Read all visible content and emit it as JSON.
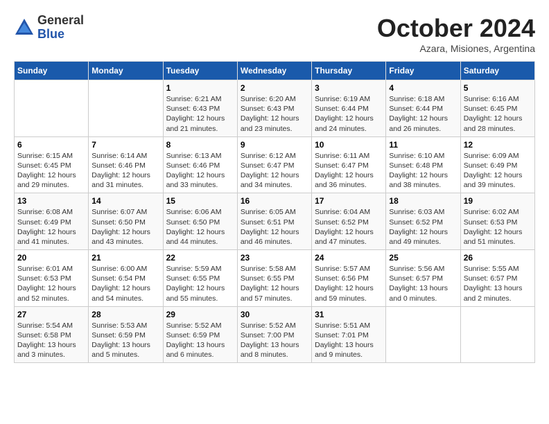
{
  "logo": {
    "general": "General",
    "blue": "Blue"
  },
  "header": {
    "month": "October 2024",
    "location": "Azara, Misiones, Argentina"
  },
  "days_of_week": [
    "Sunday",
    "Monday",
    "Tuesday",
    "Wednesday",
    "Thursday",
    "Friday",
    "Saturday"
  ],
  "weeks": [
    [
      {
        "day": "",
        "info": ""
      },
      {
        "day": "",
        "info": ""
      },
      {
        "day": "1",
        "info": "Sunrise: 6:21 AM\nSunset: 6:43 PM\nDaylight: 12 hours and 21 minutes."
      },
      {
        "day": "2",
        "info": "Sunrise: 6:20 AM\nSunset: 6:43 PM\nDaylight: 12 hours and 23 minutes."
      },
      {
        "day": "3",
        "info": "Sunrise: 6:19 AM\nSunset: 6:44 PM\nDaylight: 12 hours and 24 minutes."
      },
      {
        "day": "4",
        "info": "Sunrise: 6:18 AM\nSunset: 6:44 PM\nDaylight: 12 hours and 26 minutes."
      },
      {
        "day": "5",
        "info": "Sunrise: 6:16 AM\nSunset: 6:45 PM\nDaylight: 12 hours and 28 minutes."
      }
    ],
    [
      {
        "day": "6",
        "info": "Sunrise: 6:15 AM\nSunset: 6:45 PM\nDaylight: 12 hours and 29 minutes."
      },
      {
        "day": "7",
        "info": "Sunrise: 6:14 AM\nSunset: 6:46 PM\nDaylight: 12 hours and 31 minutes."
      },
      {
        "day": "8",
        "info": "Sunrise: 6:13 AM\nSunset: 6:46 PM\nDaylight: 12 hours and 33 minutes."
      },
      {
        "day": "9",
        "info": "Sunrise: 6:12 AM\nSunset: 6:47 PM\nDaylight: 12 hours and 34 minutes."
      },
      {
        "day": "10",
        "info": "Sunrise: 6:11 AM\nSunset: 6:47 PM\nDaylight: 12 hours and 36 minutes."
      },
      {
        "day": "11",
        "info": "Sunrise: 6:10 AM\nSunset: 6:48 PM\nDaylight: 12 hours and 38 minutes."
      },
      {
        "day": "12",
        "info": "Sunrise: 6:09 AM\nSunset: 6:49 PM\nDaylight: 12 hours and 39 minutes."
      }
    ],
    [
      {
        "day": "13",
        "info": "Sunrise: 6:08 AM\nSunset: 6:49 PM\nDaylight: 12 hours and 41 minutes."
      },
      {
        "day": "14",
        "info": "Sunrise: 6:07 AM\nSunset: 6:50 PM\nDaylight: 12 hours and 43 minutes."
      },
      {
        "day": "15",
        "info": "Sunrise: 6:06 AM\nSunset: 6:50 PM\nDaylight: 12 hours and 44 minutes."
      },
      {
        "day": "16",
        "info": "Sunrise: 6:05 AM\nSunset: 6:51 PM\nDaylight: 12 hours and 46 minutes."
      },
      {
        "day": "17",
        "info": "Sunrise: 6:04 AM\nSunset: 6:52 PM\nDaylight: 12 hours and 47 minutes."
      },
      {
        "day": "18",
        "info": "Sunrise: 6:03 AM\nSunset: 6:52 PM\nDaylight: 12 hours and 49 minutes."
      },
      {
        "day": "19",
        "info": "Sunrise: 6:02 AM\nSunset: 6:53 PM\nDaylight: 12 hours and 51 minutes."
      }
    ],
    [
      {
        "day": "20",
        "info": "Sunrise: 6:01 AM\nSunset: 6:53 PM\nDaylight: 12 hours and 52 minutes."
      },
      {
        "day": "21",
        "info": "Sunrise: 6:00 AM\nSunset: 6:54 PM\nDaylight: 12 hours and 54 minutes."
      },
      {
        "day": "22",
        "info": "Sunrise: 5:59 AM\nSunset: 6:55 PM\nDaylight: 12 hours and 55 minutes."
      },
      {
        "day": "23",
        "info": "Sunrise: 5:58 AM\nSunset: 6:55 PM\nDaylight: 12 hours and 57 minutes."
      },
      {
        "day": "24",
        "info": "Sunrise: 5:57 AM\nSunset: 6:56 PM\nDaylight: 12 hours and 59 minutes."
      },
      {
        "day": "25",
        "info": "Sunrise: 5:56 AM\nSunset: 6:57 PM\nDaylight: 13 hours and 0 minutes."
      },
      {
        "day": "26",
        "info": "Sunrise: 5:55 AM\nSunset: 6:57 PM\nDaylight: 13 hours and 2 minutes."
      }
    ],
    [
      {
        "day": "27",
        "info": "Sunrise: 5:54 AM\nSunset: 6:58 PM\nDaylight: 13 hours and 3 minutes."
      },
      {
        "day": "28",
        "info": "Sunrise: 5:53 AM\nSunset: 6:59 PM\nDaylight: 13 hours and 5 minutes."
      },
      {
        "day": "29",
        "info": "Sunrise: 5:52 AM\nSunset: 6:59 PM\nDaylight: 13 hours and 6 minutes."
      },
      {
        "day": "30",
        "info": "Sunrise: 5:52 AM\nSunset: 7:00 PM\nDaylight: 13 hours and 8 minutes."
      },
      {
        "day": "31",
        "info": "Sunrise: 5:51 AM\nSunset: 7:01 PM\nDaylight: 13 hours and 9 minutes."
      },
      {
        "day": "",
        "info": ""
      },
      {
        "day": "",
        "info": ""
      }
    ]
  ]
}
